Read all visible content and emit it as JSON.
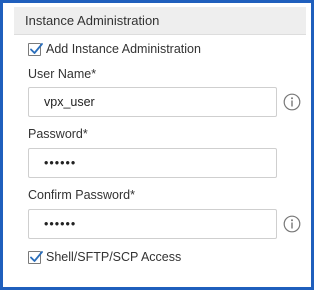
{
  "section": {
    "title": "Instance Administration"
  },
  "add_instance_admin": {
    "label": "Add Instance Administration",
    "checked": true
  },
  "user_name": {
    "label": "User Name*",
    "value": "vpx_user",
    "icon": "info-icon"
  },
  "password": {
    "label": "Password*",
    "value": "••••••"
  },
  "confirm_password": {
    "label": "Confirm Password*",
    "value": "••••••",
    "icon": "info-icon"
  },
  "shell_access": {
    "label": "Shell/SFTP/SCP Access",
    "checked": true
  },
  "colors": {
    "frame_border": "#1f5fbd",
    "header_bg": "#eeeeee",
    "checkmark": "#2a6ebb",
    "text": "#333333"
  }
}
